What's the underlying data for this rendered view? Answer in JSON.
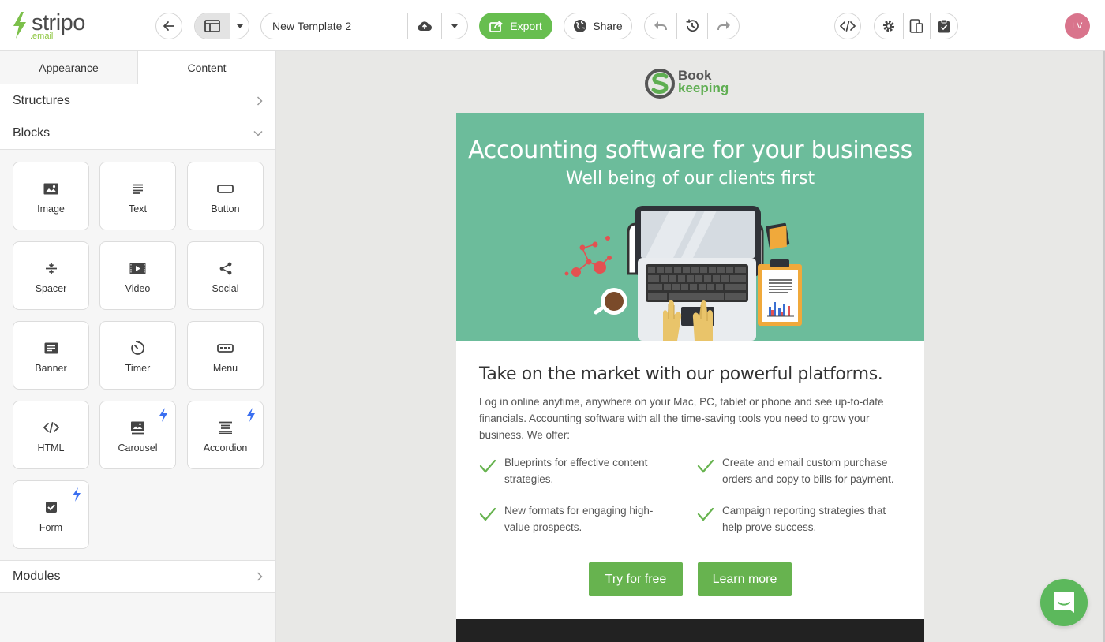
{
  "app": {
    "logo_text": "stripo",
    "logo_sub": ".email",
    "template_name": "New Template 2",
    "export_label": "Export",
    "share_label": "Share",
    "avatar_initials": "LV",
    "accent_color": "#67be4f"
  },
  "sidebar": {
    "tabs": [
      {
        "label": "Appearance",
        "active": false
      },
      {
        "label": "Content",
        "active": true
      }
    ],
    "sections": {
      "structures": "Structures",
      "blocks": "Blocks",
      "modules": "Modules"
    },
    "blocks": [
      {
        "label": "Image",
        "icon": "image-icon",
        "amp": false
      },
      {
        "label": "Text",
        "icon": "text-icon",
        "amp": false
      },
      {
        "label": "Button",
        "icon": "button-icon",
        "amp": false
      },
      {
        "label": "Spacer",
        "icon": "spacer-icon",
        "amp": false
      },
      {
        "label": "Video",
        "icon": "video-icon",
        "amp": false
      },
      {
        "label": "Social",
        "icon": "share-icon",
        "amp": false
      },
      {
        "label": "Banner",
        "icon": "banner-icon",
        "amp": false
      },
      {
        "label": "Timer",
        "icon": "timer-icon",
        "amp": false
      },
      {
        "label": "Menu",
        "icon": "menu-icon",
        "amp": false
      },
      {
        "label": "HTML",
        "icon": "code-icon",
        "amp": false
      },
      {
        "label": "Carousel",
        "icon": "carousel-icon",
        "amp": true
      },
      {
        "label": "Accordion",
        "icon": "accordion-icon",
        "amp": true
      },
      {
        "label": "Form",
        "icon": "checkbox-icon",
        "amp": true
      }
    ]
  },
  "email": {
    "brand": {
      "line1": "Book",
      "line2": "keeping"
    },
    "hero_title": "Accounting software for your business",
    "hero_subtitle": "Well being of our clients first",
    "hero_bg": "#6cbc9b",
    "heading": "Take on the market with our powerful platforms.",
    "intro": "Log in online anytime, anywhere on your Mac, PC, tablet or phone and see up-to-date financials. Accounting software with all the time-saving tools you need to grow your business. We offer:",
    "features": [
      "Blueprints for effective content strategies.",
      "Create and email custom purchase orders and copy to bills for payment.",
      "New formats for engaging high-value prospects.",
      "Campaign reporting strategies that help prove success."
    ],
    "buttons": {
      "primary": "Try for free",
      "secondary": "Learn more"
    },
    "button_color": "#67b34f"
  }
}
